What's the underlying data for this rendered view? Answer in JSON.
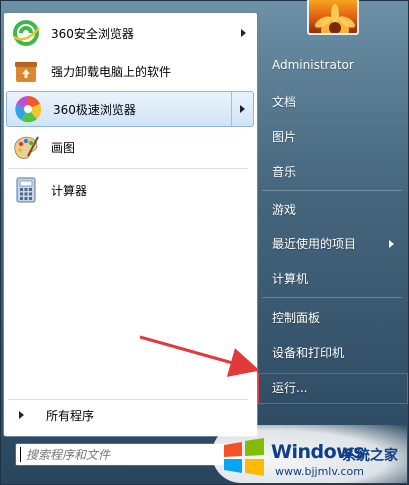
{
  "programs": [
    {
      "label": "360安全浏览器",
      "icon": "360-safe-browser-icon",
      "has_submenu": true
    },
    {
      "label": "强力卸载电脑上的软件",
      "icon": "uninstall-box-icon",
      "has_submenu": false
    },
    {
      "label": "360极速浏览器",
      "icon": "360-extreme-browser-icon",
      "has_submenu": true,
      "highlighted": true
    },
    {
      "label": "画图",
      "icon": "paint-palette-icon",
      "has_submenu": false
    },
    {
      "label": "计算器",
      "icon": "calculator-icon",
      "has_submenu": false
    }
  ],
  "all_programs": "所有程序",
  "search": {
    "placeholder": "搜索程序和文件"
  },
  "right_menu": {
    "user": "Administrator",
    "documents": "文档",
    "pictures": "图片",
    "music": "音乐",
    "games": "游戏",
    "recent": "最近使用的项目",
    "computer": "计算机",
    "control_panel": "控制面板",
    "devices": "设备和打印机",
    "run": "运行..."
  },
  "watermark": {
    "title": "Windows",
    "subtitle": "系统之家",
    "url": "www.bjjmlv.com"
  },
  "colors": {
    "highlight_border": "#8fb6dd",
    "annotation_red": "#e23a3a",
    "watermark_blue": "#0d3e86"
  }
}
